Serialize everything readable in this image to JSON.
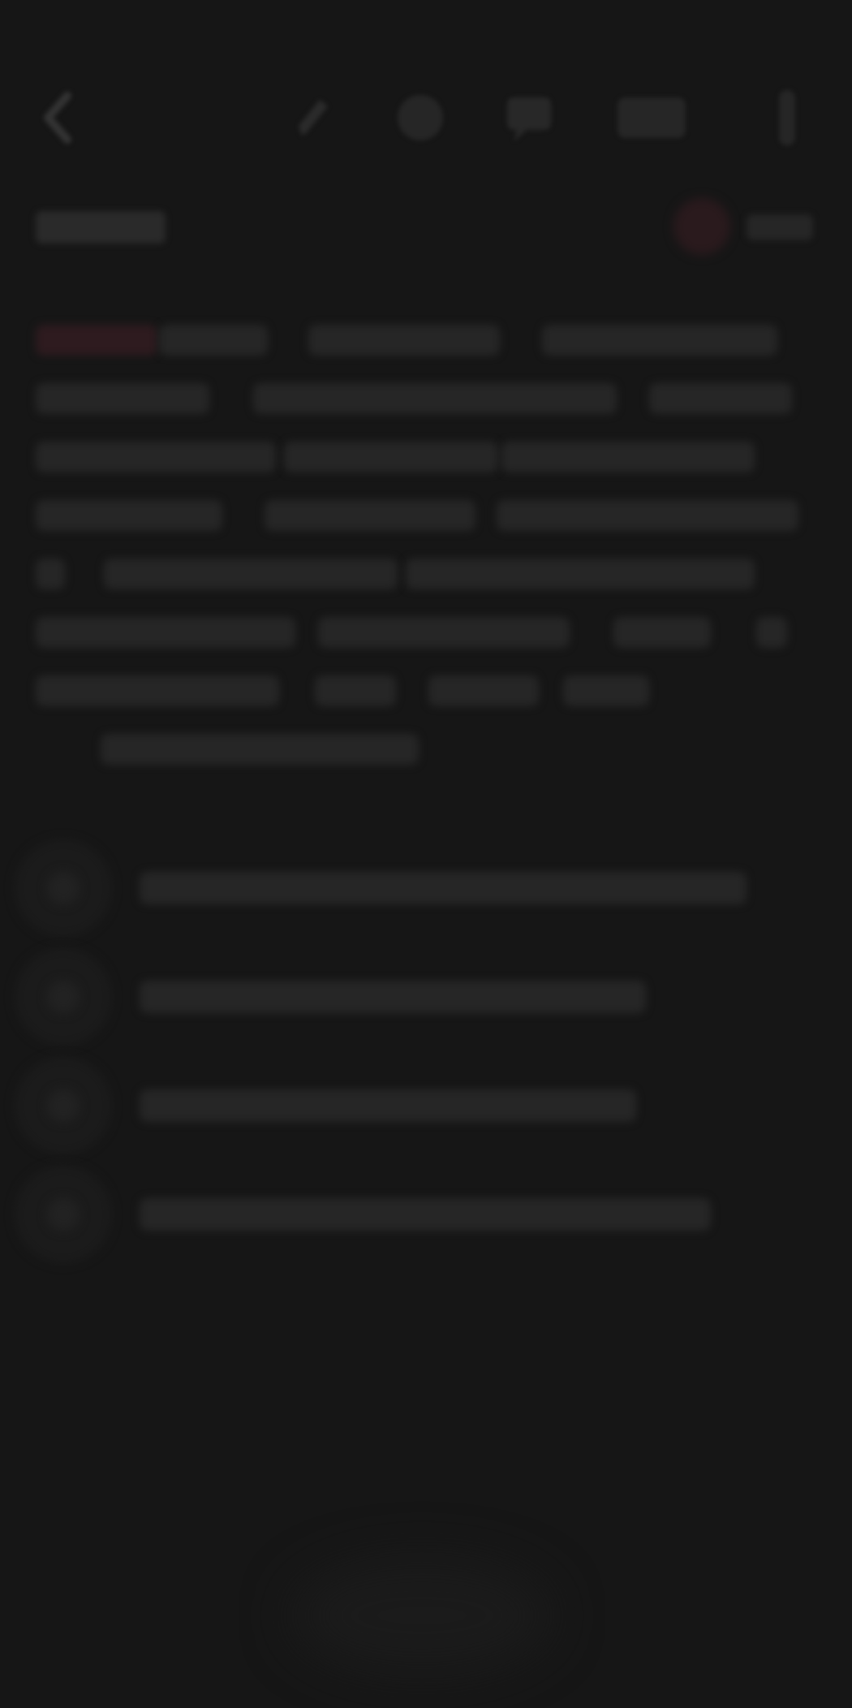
{
  "toolbar": {
    "back_icon": "chevron-left-icon",
    "edit_icon": "pencil-icon",
    "circle_icon": "circle-icon",
    "chat_icon": "speech-bubble-icon",
    "tag_icon": "tag-icon",
    "more_icon": "vertical-dots-icon"
  },
  "header": {
    "doc_label": "",
    "user_name": ""
  },
  "colors": {
    "background": "#161616",
    "placeholder": "#262626",
    "highlight": "#2e1b1f",
    "avatar": "#2a1a1d"
  },
  "question": {
    "segments": [
      "",
      "",
      "",
      "",
      "",
      "",
      "",
      "",
      "",
      "",
      "",
      "",
      "",
      "",
      "",
      "",
      "",
      "",
      "",
      "",
      "",
      "",
      "",
      "",
      ""
    ]
  },
  "options": [
    {
      "letter": "",
      "text": ""
    },
    {
      "letter": "",
      "text": ""
    },
    {
      "letter": "",
      "text": ""
    },
    {
      "letter": "",
      "text": ""
    }
  ]
}
